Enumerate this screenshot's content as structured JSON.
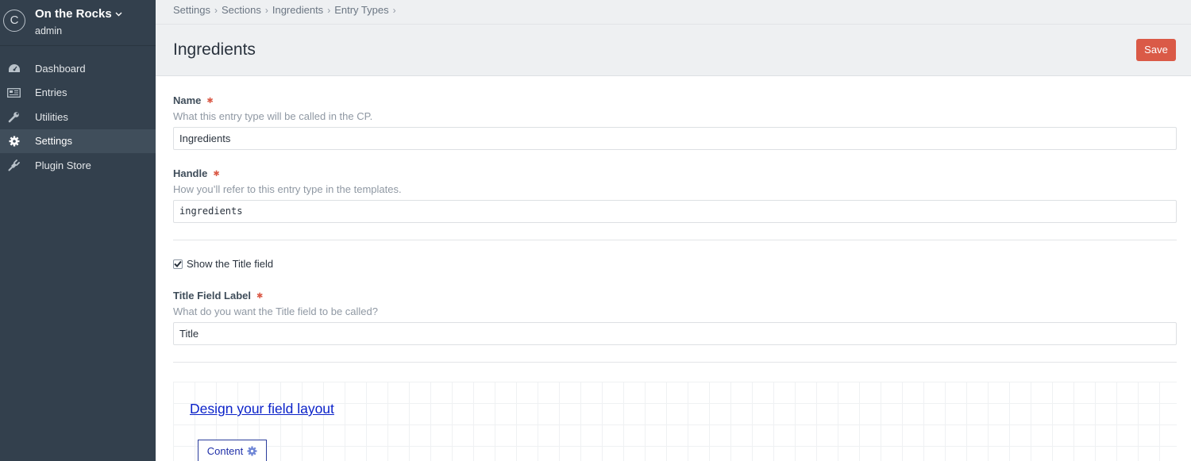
{
  "site": {
    "logo_letter": "C",
    "name": "On the Rocks",
    "user": "admin"
  },
  "nav": {
    "items": [
      {
        "label": "Dashboard",
        "icon": "dashboard-icon",
        "active": false
      },
      {
        "label": "Entries",
        "icon": "entries-icon",
        "active": false
      },
      {
        "label": "Utilities",
        "icon": "wrench-icon",
        "active": false
      },
      {
        "label": "Settings",
        "icon": "gear-icon",
        "active": true
      },
      {
        "label": "Plugin Store",
        "icon": "plug-icon",
        "active": false
      }
    ]
  },
  "breadcrumbs": [
    "Settings",
    "Sections",
    "Ingredients",
    "Entry Types"
  ],
  "page": {
    "title": "Ingredients",
    "save_label": "Save"
  },
  "fields": {
    "name": {
      "label": "Name",
      "instructions": "What this entry type will be called in the CP.",
      "value": "Ingredients"
    },
    "handle": {
      "label": "Handle",
      "instructions": "How you’ll refer to this entry type in the templates.",
      "value": "ingredients"
    },
    "show_title": {
      "label": "Show the Title field",
      "checked": true
    },
    "title_label": {
      "label": "Title Field Label",
      "instructions": "What do you want the Title field to be called?",
      "value": "Title"
    }
  },
  "layout": {
    "design_link": "Design your field layout",
    "tab_label": "Content"
  },
  "colors": {
    "sidebar": "#33404d",
    "accent_save": "#da5a47",
    "link": "#0b22c9",
    "required": "#da5a47"
  }
}
